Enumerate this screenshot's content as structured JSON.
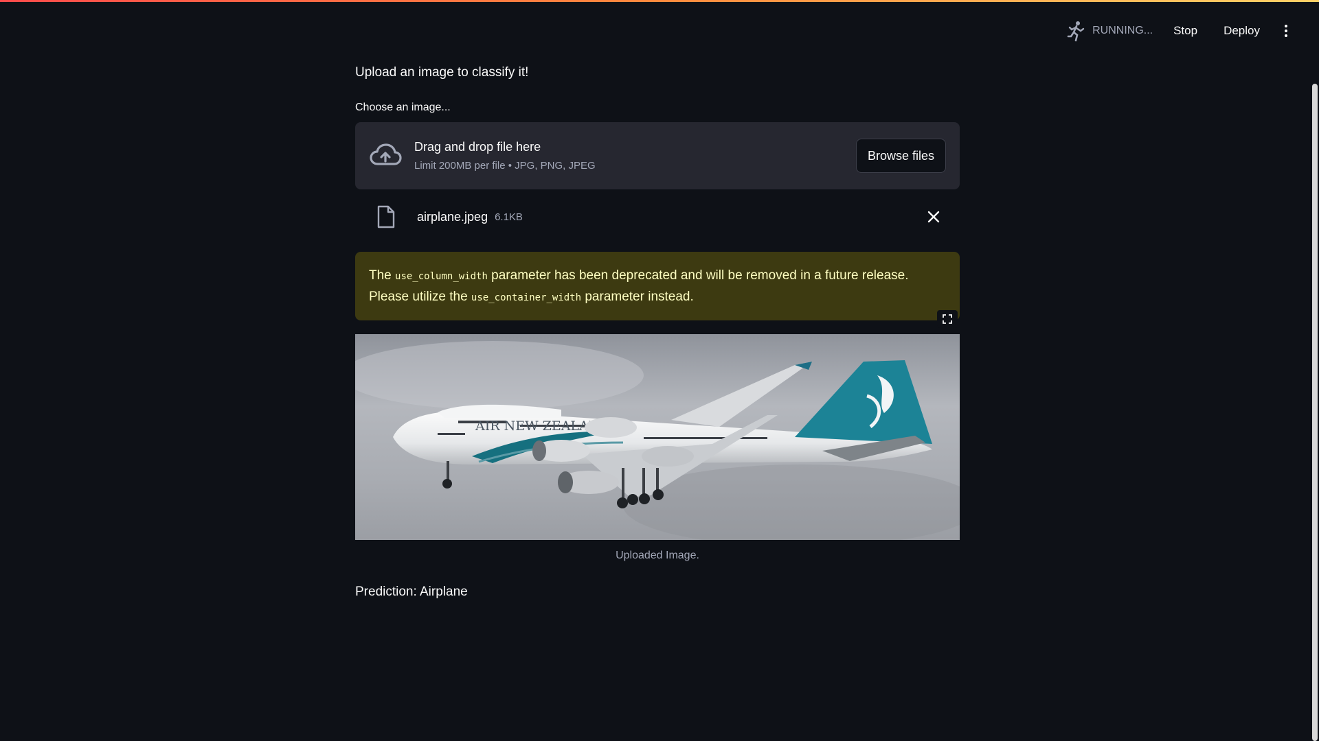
{
  "header": {
    "status": "RUNNING...",
    "stop_label": "Stop",
    "deploy_label": "Deploy",
    "menu_icon": "kebab-menu-icon",
    "status_icon": "running-man-icon"
  },
  "main": {
    "intro_text": "Upload an image to classify it!",
    "uploader": {
      "label": "Choose an image...",
      "drop_title": "Drag and drop file here",
      "limit_text": "Limit 200MB per file • JPG, PNG, JPEG",
      "browse_label": "Browse files",
      "icon": "cloud-upload-icon"
    },
    "uploaded_file": {
      "name": "airplane.jpeg",
      "size": "6.1KB",
      "icon": "file-icon",
      "remove_icon": "close-icon"
    },
    "warning": {
      "part1": "The ",
      "code1": "use_column_width",
      "part2": " parameter has been deprecated and will be removed in a future release. Please utilize the ",
      "code2": "use_container_width",
      "part3": " parameter instead."
    },
    "image": {
      "caption": "Uploaded Image.",
      "livery_text": "AIR NEW ZEALAND",
      "fullscreen_icon": "fullscreen-icon"
    },
    "prediction": "Prediction: Airplane"
  },
  "colors": {
    "background": "#0e1117",
    "dropzone": "#262730",
    "warning_bg": "#3d3a11",
    "warning_text": "#ffffc2",
    "muted_text": "#a3a8b8"
  }
}
